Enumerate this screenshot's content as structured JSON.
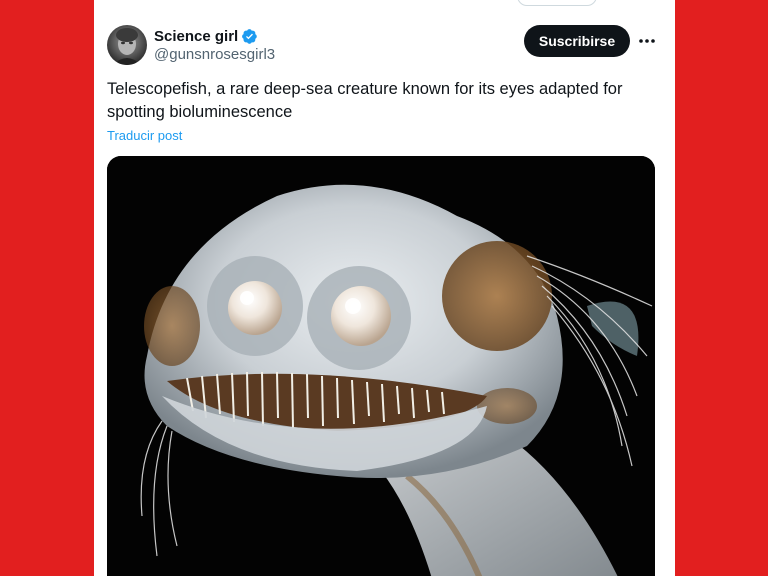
{
  "post": {
    "author": {
      "display_name": "Science girl",
      "handle": "@gunsnrosesgirl3",
      "verified_icon": "verified-badge-icon"
    },
    "subscribe_label": "Suscribirse",
    "more_icon": "more-horizontal-icon",
    "text": "Telescopefish, a rare deep-sea creature known for its eyes adapted for spotting bioluminescence",
    "translate_label": "Traducir post",
    "media_icon": "telescopefish-photo"
  },
  "colors": {
    "background": "#e21f1f",
    "card": "#ffffff",
    "primary_text": "#0f1419",
    "secondary_text": "#536471",
    "link": "#1d9bf0",
    "button": "#0f1419"
  }
}
